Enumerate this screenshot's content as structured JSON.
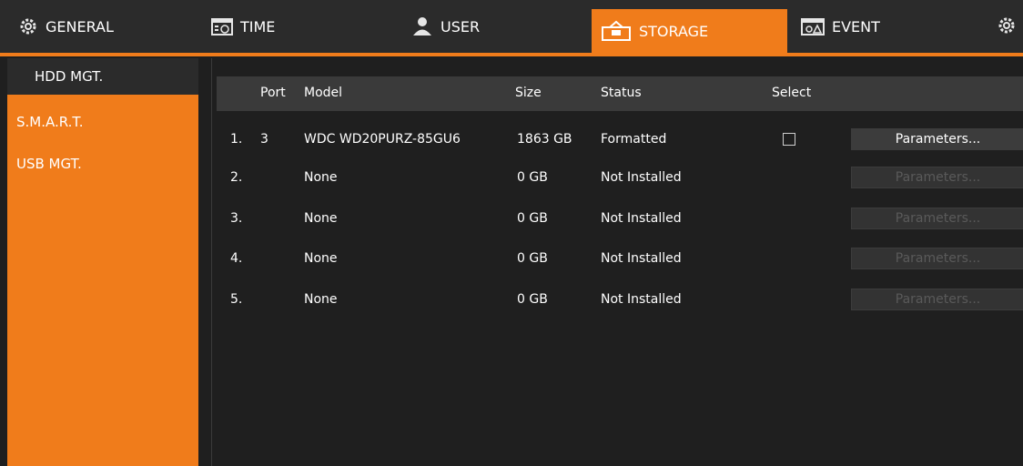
{
  "colors": {
    "accent": "#f07c1b",
    "panel": "#2b2b2b",
    "background": "#1f1f1f"
  },
  "tabs": [
    {
      "label": "GENERAL",
      "icon": "gear-icon"
    },
    {
      "label": "TIME",
      "icon": "calendar-clock-icon"
    },
    {
      "label": "USER",
      "icon": "user-icon"
    },
    {
      "label": "STORAGE",
      "icon": "storage-icon",
      "active": true
    },
    {
      "label": "EVENT",
      "icon": "event-alarm-icon"
    }
  ],
  "left_menu": [
    {
      "label": "HDD MGT.",
      "active": true
    },
    {
      "label": "S.M.A.R.T."
    },
    {
      "label": "USB MGT."
    }
  ],
  "table": {
    "headers": {
      "port": "Port",
      "model": "Model",
      "size": "Size",
      "status": "Status",
      "select": "Select"
    },
    "rows": [
      {
        "index": "1.",
        "port": "3",
        "model": "WDC WD20PURZ-85GU6",
        "size": "1863 GB",
        "status": "Formatted",
        "selectable": true,
        "button": "Parameters..."
      },
      {
        "index": "2.",
        "port": "",
        "model": "None",
        "size": "0 GB",
        "status": "Not Installed",
        "selectable": false,
        "button": "Parameters..."
      },
      {
        "index": "3.",
        "port": "",
        "model": "None",
        "size": "0 GB",
        "status": "Not Installed",
        "selectable": false,
        "button": "Parameters..."
      },
      {
        "index": "4.",
        "port": "",
        "model": "None",
        "size": "0 GB",
        "status": "Not Installed",
        "selectable": false,
        "button": "Parameters..."
      },
      {
        "index": "5.",
        "port": "",
        "model": "None",
        "size": "0 GB",
        "status": "Not Installed",
        "selectable": false,
        "button": "Parameters..."
      }
    ]
  }
}
